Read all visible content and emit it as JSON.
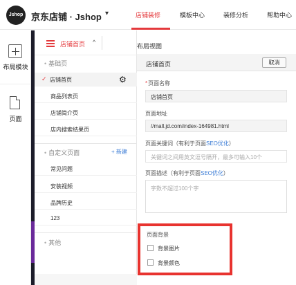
{
  "topbar": {
    "logo_text": "Jshop",
    "brand": "京东店铺 · Jshop",
    "brand_caret": "▾",
    "nav": [
      {
        "label": "店铺装修",
        "active": true
      },
      {
        "label": "模板中心",
        "active": false
      },
      {
        "label": "装修分析",
        "active": false
      },
      {
        "label": "帮助中心",
        "active": false
      }
    ],
    "accent_color": "#e4393c"
  },
  "rail": {
    "layout_module_label": "布局模块",
    "page_label": "页面"
  },
  "page_panel": {
    "current_page": "店铺首页",
    "caret": "^",
    "layout_view_label": "布局视图",
    "basic_section": "基础页",
    "basic_pages": [
      "店铺首页",
      "商品列表页",
      "店铺简介页",
      "店内搜索结果页"
    ],
    "custom_section": "自定义页面",
    "new_label": "+ 新建",
    "custom_pages": [
      "常见问题",
      "安装视频",
      "品牌历史",
      "123"
    ],
    "other_section": "其他"
  },
  "settings": {
    "title": "店铺首页",
    "cancel": "取消",
    "page_name_label": "页面名称",
    "page_name_value": "店铺首页",
    "page_url_label": "页面地址",
    "page_url_value": "//mall.jd.com/index-164981.html",
    "keywords_label_prefix": "页面关键词（有利于页面",
    "keywords_label_seo": "SEO优化",
    "keywords_label_suffix": "）",
    "keywords_placeholder": "关键词之间用英文逗号隔开，最多可输入10个",
    "desc_label_prefix": "页面描述（有利于页面",
    "desc_label_seo": "SEO优化",
    "desc_label_suffix": "）",
    "desc_placeholder": "字数不超过100个字",
    "bg_section": "页面背景",
    "bg_image": "背景图片",
    "bg_color": "背景颜色",
    "highlight_color": "#e8332f"
  }
}
